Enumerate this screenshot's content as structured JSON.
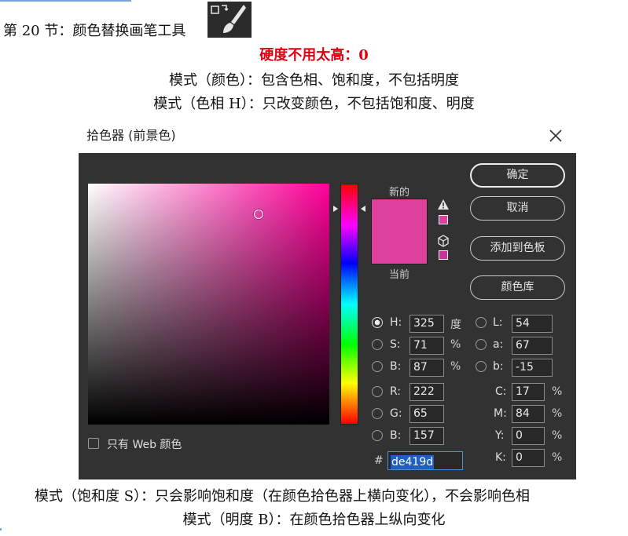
{
  "doc": {
    "heading": "第 20 节：颜色替换画笔工具",
    "hardness_note": "硬度不用太高：0",
    "mode_color": "模式（颜色）：包含色相、饱和度，不包括明度",
    "mode_hue": "模式（色相 H）：只改变颜色，不包括饱和度、明度",
    "mode_saturation": "模式（饱和度 S）：只会影响饱和度（在颜色拾色器上横向变化），不会影响色相",
    "mode_brightness": "模式（明度 B）：在颜色拾色器上纵向变化"
  },
  "tool_icon": "color-replacement-brush-icon",
  "dialog": {
    "title": "拾色器 (前景色)",
    "close_icon": "close-icon",
    "label_new": "新的",
    "label_current": "当前",
    "buttons": {
      "ok": "确定",
      "cancel": "取消",
      "add_to_swatches": "添加到色板",
      "color_libraries": "颜色库"
    },
    "only_web_colors": "只有 Web 颜色",
    "hsb": {
      "h": {
        "label": "H:",
        "value": "325",
        "unit": "度"
      },
      "s": {
        "label": "S:",
        "value": "71",
        "unit": "%"
      },
      "b": {
        "label": "B:",
        "value": "87",
        "unit": "%"
      }
    },
    "rgb": {
      "r": {
        "label": "R:",
        "value": "222"
      },
      "g": {
        "label": "G:",
        "value": "65"
      },
      "b": {
        "label": "B:",
        "value": "157"
      }
    },
    "lab": {
      "l": {
        "label": "L:",
        "value": "54"
      },
      "a": {
        "label": "a:",
        "value": "67"
      },
      "b": {
        "label": "b:",
        "value": "-15"
      }
    },
    "cmyk": {
      "c": {
        "label": "C:",
        "value": "17",
        "unit": "%"
      },
      "m": {
        "label": "M:",
        "value": "84",
        "unit": "%"
      },
      "y": {
        "label": "Y:",
        "value": "0",
        "unit": "%"
      },
      "k": {
        "label": "K:",
        "value": "0",
        "unit": "%"
      }
    },
    "hash": "#",
    "hex": "de419d",
    "colors": {
      "swatch_new": "#de419d",
      "swatch_current": "#de419d",
      "hue_base": "#ff0099",
      "panel_bg": "#323232"
    }
  }
}
